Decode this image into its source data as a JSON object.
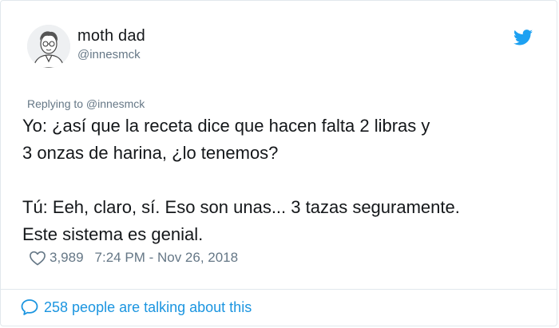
{
  "author": {
    "display_name": "moth dad",
    "handle": "@innesmck"
  },
  "reply_context": "Replying to @innesmck",
  "tweet": {
    "line1": "Yo: ¿así que la receta dice que hacen falta 2 libras y",
    "line2": "3 onzas de harina, ¿lo tenemos?",
    "line3": "Tú: Eeh, claro, sí. Eso son unas... 3 tazas seguramente.",
    "line4": "Este sistema es genial."
  },
  "stats": {
    "likes": "3,989",
    "timestamp": "7:24 PM - Nov 26, 2018"
  },
  "footer": {
    "talking": "258 people are talking about this"
  },
  "icons": {
    "brand": "twitter-bird-icon",
    "like": "heart-icon",
    "reply": "speech-bubble-icon"
  },
  "colors": {
    "brand_blue": "#1da1f2",
    "link_blue": "#1b95e0",
    "secondary_text": "#657786",
    "primary_text": "#14171a",
    "border": "#e1e8ed"
  }
}
